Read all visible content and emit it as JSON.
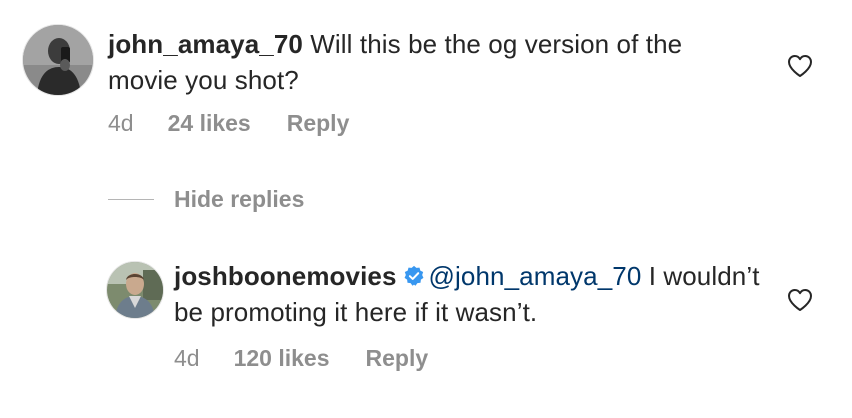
{
  "comments": [
    {
      "username": "john_amaya_70",
      "text": " Will this be the og version of the movie you shot?",
      "time": "4d",
      "likes": "24 likes",
      "reply_label": "Reply",
      "avatar": "avatar-man-taking-mirror-selfie",
      "like_icon": "heart-outline-icon"
    },
    {
      "username": "joshboonemovies",
      "verified_icon": "verified-badge-icon",
      "mention": "@john_amaya_70",
      "text": " I wouldn’t be promoting it here if it wasn’t.",
      "time": "4d",
      "likes": "120 likes",
      "reply_label": "Reply",
      "avatar": "avatar-man-outdoors",
      "like_icon": "heart-outline-icon"
    }
  ],
  "thread": {
    "hide_replies_label": "Hide replies"
  },
  "colors": {
    "text": "#262626",
    "muted": "#8e8e8e",
    "mention": "#00376b",
    "verified": "#3897f0"
  }
}
